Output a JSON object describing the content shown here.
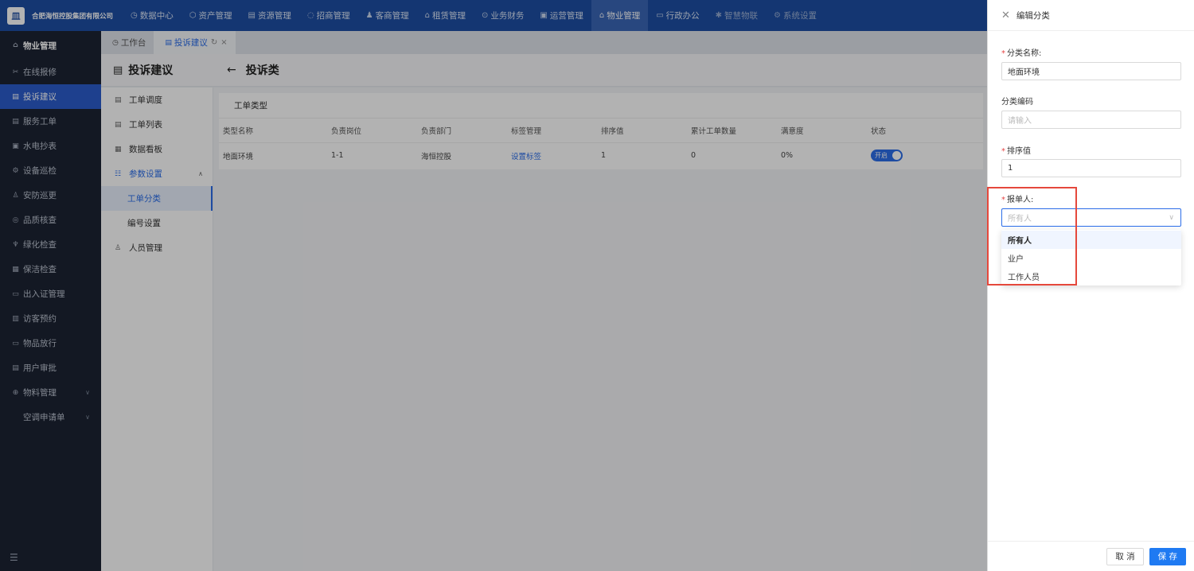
{
  "header": {
    "company": "合肥海恒控股集团有限公司",
    "logo_char": "皿",
    "nav": [
      {
        "icon": "◷",
        "label": "数据中心"
      },
      {
        "icon": "⬡",
        "label": "资产管理"
      },
      {
        "icon": "▤",
        "label": "资源管理"
      },
      {
        "icon": "◌",
        "label": "招商管理"
      },
      {
        "icon": "♟",
        "label": "客商管理"
      },
      {
        "icon": "⌂",
        "label": "租赁管理"
      },
      {
        "icon": "⊙",
        "label": "业务财务"
      },
      {
        "icon": "▣",
        "label": "运营管理"
      },
      {
        "icon": "⌂",
        "label": "物业管理"
      },
      {
        "icon": "▭",
        "label": "行政办公"
      },
      {
        "icon": "✱",
        "label": "智慧物联"
      },
      {
        "icon": "⚙",
        "label": "系统设置"
      }
    ]
  },
  "sidebar": {
    "title": "物业管理",
    "items": [
      {
        "icon": "✂",
        "label": "在线报修"
      },
      {
        "icon": "▤",
        "label": "投诉建议"
      },
      {
        "icon": "▤",
        "label": "服务工单"
      },
      {
        "icon": "▣",
        "label": "水电抄表"
      },
      {
        "icon": "⚙",
        "label": "设备巡检"
      },
      {
        "icon": "♙",
        "label": "安防巡更"
      },
      {
        "icon": "◎",
        "label": "品质核查"
      },
      {
        "icon": "♆",
        "label": "绿化检查"
      },
      {
        "icon": "▦",
        "label": "保洁检查"
      },
      {
        "icon": "▭",
        "label": "出入证管理"
      },
      {
        "icon": "▥",
        "label": "访客预约"
      },
      {
        "icon": "▭",
        "label": "物品放行"
      },
      {
        "icon": "▤",
        "label": "用户审批"
      },
      {
        "icon": "⊕",
        "label": "物料管理"
      },
      {
        "icon": "",
        "label": "空调申请单"
      }
    ],
    "collapse_icon": "☰"
  },
  "tabs": [
    {
      "icon": "◷",
      "label": "工作台"
    },
    {
      "icon": "▤",
      "label": "投诉建议"
    }
  ],
  "page": {
    "title": "投诉建议",
    "title_icon": "▤",
    "back_icon": "←",
    "subtitle": "投诉类"
  },
  "submenu": {
    "items": [
      {
        "icon": "▤",
        "label": "工单调度"
      },
      {
        "icon": "▤",
        "label": "工单列表"
      },
      {
        "icon": "▦",
        "label": "数据看板"
      },
      {
        "icon": "☷",
        "label": "参数设置"
      }
    ],
    "children": [
      "工单分类",
      "编号设置"
    ],
    "last": {
      "icon": "♙",
      "label": "人员管理"
    }
  },
  "table": {
    "section_title": "工单类型",
    "columns": [
      "类型名称",
      "负责岗位",
      "负责部门",
      "标签管理",
      "排序值",
      "累计工单数量",
      "满意度",
      "状态"
    ],
    "rows": [
      {
        "name": "地面环境",
        "post": "1-1",
        "dept": "海恒控股",
        "tag": "设置标签",
        "sort": "1",
        "count": "0",
        "satisfaction": "0%",
        "status": "开启"
      }
    ]
  },
  "drawer": {
    "title": "编辑分类",
    "close_icon": "✕",
    "fields": {
      "name_label": "分类名称:",
      "name_value": "地面环境",
      "code_label": "分类编码",
      "code_placeholder": "请输入",
      "sort_label": "排序值",
      "sort_value": "1",
      "reporter_label": "报单人:",
      "reporter_placeholder": "所有人"
    },
    "dropdown_options": [
      "所有人",
      "业户",
      "工作人员"
    ],
    "cancel_label": "取 消",
    "save_label": "保 存"
  },
  "colors": {
    "topbar": "#1d4ea4",
    "sidebar": "#1c2333",
    "primary": "#2b6de8",
    "highlight": "#e5483c"
  }
}
